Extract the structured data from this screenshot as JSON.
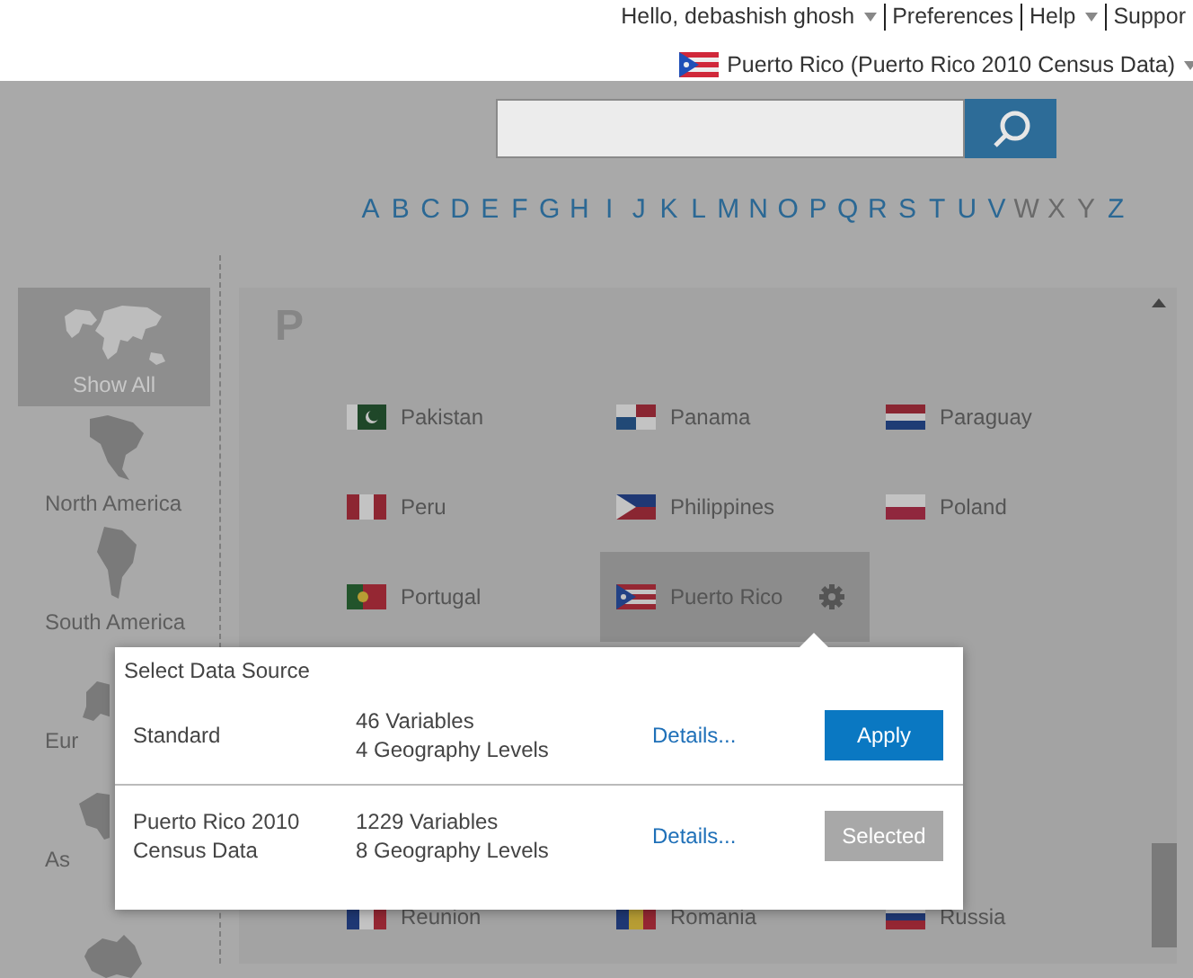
{
  "header": {
    "menu": [
      {
        "label": "Hello, debashish ghosh",
        "dropdown": true
      },
      {
        "label": "Preferences",
        "dropdown": false
      },
      {
        "label": "Help",
        "dropdown": true
      },
      {
        "label": "Suppor",
        "dropdown": false
      }
    ],
    "dataset": {
      "label": "Puerto Rico (Puerto Rico 2010 Census Data)",
      "dropdown": true
    }
  },
  "alphabet": [
    {
      "letter": "A",
      "disabled": false
    },
    {
      "letter": "B",
      "disabled": false
    },
    {
      "letter": "C",
      "disabled": false
    },
    {
      "letter": "D",
      "disabled": false
    },
    {
      "letter": "E",
      "disabled": false
    },
    {
      "letter": "F",
      "disabled": false
    },
    {
      "letter": "G",
      "disabled": false
    },
    {
      "letter": "H",
      "disabled": false
    },
    {
      "letter": "I",
      "disabled": false
    },
    {
      "letter": "J",
      "disabled": false
    },
    {
      "letter": "K",
      "disabled": false
    },
    {
      "letter": "L",
      "disabled": false
    },
    {
      "letter": "M",
      "disabled": false
    },
    {
      "letter": "N",
      "disabled": false
    },
    {
      "letter": "O",
      "disabled": false
    },
    {
      "letter": "P",
      "disabled": false
    },
    {
      "letter": "Q",
      "disabled": false
    },
    {
      "letter": "R",
      "disabled": false
    },
    {
      "letter": "S",
      "disabled": false
    },
    {
      "letter": "T",
      "disabled": false
    },
    {
      "letter": "U",
      "disabled": false
    },
    {
      "letter": "V",
      "disabled": false
    },
    {
      "letter": "W",
      "disabled": true
    },
    {
      "letter": "X",
      "disabled": true
    },
    {
      "letter": "Y",
      "disabled": true
    },
    {
      "letter": "Z",
      "disabled": false
    }
  ],
  "regions": [
    {
      "label": "Show All",
      "selected": true
    },
    {
      "label": "North America",
      "selected": false
    },
    {
      "label": "South America",
      "selected": false
    },
    {
      "label": "Eur",
      "selected": false
    },
    {
      "label": "As",
      "selected": false
    },
    {
      "selected": false
    }
  ],
  "section": {
    "letter": "P",
    "countries": [
      {
        "name": "Pakistan",
        "selected": false
      },
      {
        "name": "Panama",
        "selected": false
      },
      {
        "name": "Paraguay",
        "selected": false
      },
      {
        "name": "Peru",
        "selected": false
      },
      {
        "name": "Philippines",
        "selected": false
      },
      {
        "name": "Poland",
        "selected": false
      },
      {
        "name": "Portugal",
        "selected": false
      },
      {
        "name": "Puerto Rico",
        "selected": true
      },
      {
        "name": "Reunion",
        "selected": false
      },
      {
        "name": "Romania",
        "selected": false
      },
      {
        "name": "Russia",
        "selected": false
      }
    ]
  },
  "popup": {
    "title": "Select Data Source",
    "sources": [
      {
        "name": "Standard",
        "variables": "46 Variables",
        "levels": "4 Geography Levels",
        "details": "Details...",
        "button": "Apply",
        "selected": false
      },
      {
        "name": "Puerto Rico 2010 Census Data",
        "variables": "1229 Variables",
        "levels": "8 Geography Levels",
        "details": "Details...",
        "button": "Selected",
        "selected": true
      }
    ]
  }
}
